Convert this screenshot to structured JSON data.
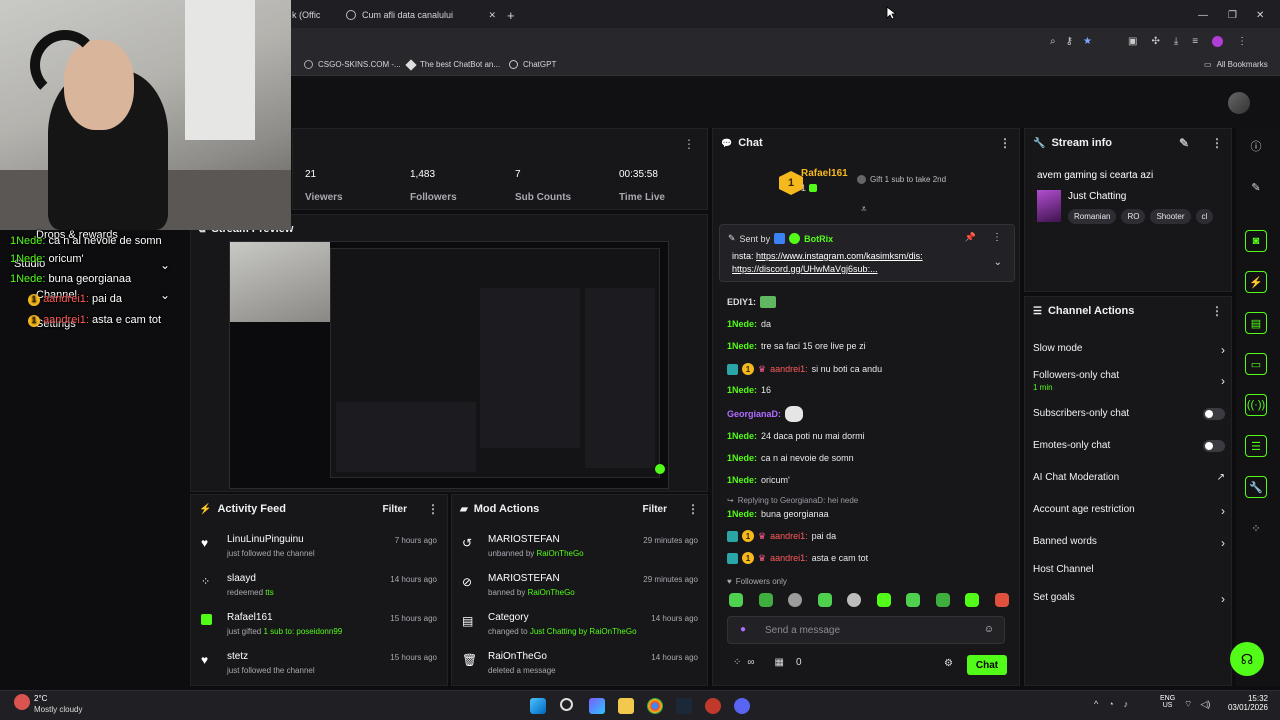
{
  "browser": {
    "tabs": [
      {
        "label": "k (Offic"
      },
      {
        "label": "Cum afli data canalului"
      }
    ],
    "bookmarks": [
      "CSGO-SKINS.COM -...",
      "The best ChatBot an...",
      "ChatGPT"
    ],
    "all_bookmarks": "All Bookmarks"
  },
  "stats": {
    "viewers": {
      "value": "21",
      "label": "Viewers"
    },
    "followers": {
      "value": "1,483",
      "label": "Followers"
    },
    "subs": {
      "value": "7",
      "label": "Sub Counts"
    },
    "time_live": {
      "value": "00:35:58",
      "label": "Time Live"
    }
  },
  "overlay_chat": [
    {
      "user": "1Nede:",
      "text": "ca n al nevoie de somn"
    },
    {
      "user": "1Nede:",
      "text": "oricum'"
    },
    {
      "user": "1Nede:",
      "text": "buna georgianaa"
    },
    {
      "user": "aandrei1:",
      "text": "pai da"
    },
    {
      "user": "aandrei1:",
      "text": "asta e cam tot"
    }
  ],
  "overlay_menu": [
    "Drops & rewards",
    "Studio",
    "Channel",
    "Settings"
  ],
  "stream_preview": {
    "title": "Stream Preview"
  },
  "chat": {
    "title": "Chat",
    "top_gifter": {
      "name": "Rafael161",
      "count": "1",
      "rank": "1",
      "cta": "Gift 1 sub to take 2nd"
    },
    "pinned": {
      "sent_by": "Sent by",
      "bot": "BotRix",
      "text_prefix": "insta:",
      "link1": "https://www.instagram.com/kasimksm/dis:",
      "link2": "https://discord.gg/UHwMaVgj6sub:..."
    },
    "messages": [
      {
        "user": "EDIY1:",
        "text": "",
        "type": "plain"
      },
      {
        "user": "1Nede:",
        "text": "da",
        "type": "green"
      },
      {
        "user": "1Nede:",
        "text": "tre sa faci 15 ore live pe zi",
        "type": "green"
      },
      {
        "user": "aandrei1:",
        "text": "si nu boti ca andu",
        "type": "red"
      },
      {
        "user": "1Nede:",
        "text": "16",
        "type": "green"
      },
      {
        "user": "GeorgianaD:",
        "text": "",
        "type": "purple"
      },
      {
        "user": "1Nede:",
        "text": "24 daca poti nu mai dormi",
        "type": "green"
      },
      {
        "user": "1Nede:",
        "text": "ca n ai nevoie de somn",
        "type": "green"
      },
      {
        "user": "1Nede:",
        "text": "oricum'",
        "type": "green"
      },
      {
        "user": "1Nede:",
        "text": "buna georgianaa",
        "type": "green"
      },
      {
        "user": "aandrei1:",
        "text": "pai da",
        "type": "red"
      },
      {
        "user": "aandrei1:",
        "text": "asta e cam tot",
        "type": "red"
      }
    ],
    "reply_note": "Replying to GeorgianaD: hei nede",
    "followers_only": "Followers only",
    "input_placeholder": "Send a message",
    "points": "0",
    "send_label": "Chat"
  },
  "stream_info": {
    "title": "Stream info",
    "stream_title": "avem gaming si cearta azi",
    "category": "Just Chatting",
    "tags": [
      "Romanian",
      "RO",
      "Shooter",
      "cl"
    ]
  },
  "channel_actions": {
    "title": "Channel Actions",
    "items": [
      {
        "label": "Slow mode"
      },
      {
        "label": "Followers-only chat",
        "sub": "1 min"
      },
      {
        "label": "Subscribers-only chat"
      },
      {
        "label": "Emotes-only chat"
      },
      {
        "label": "AI Chat Moderation"
      },
      {
        "label": "Account age restriction"
      },
      {
        "label": "Banned words"
      },
      {
        "label": "Host Channel"
      },
      {
        "label": "Set goals"
      }
    ]
  },
  "activity_feed": {
    "title": "Activity Feed",
    "filter": "Filter",
    "rows": [
      {
        "name": "LinuLinuPinguinu",
        "sub": "just followed the channel",
        "time": "7 hours ago",
        "icon": "heart-icon"
      },
      {
        "name": "slaayd",
        "sub": "redeemed",
        "highlight": "tts",
        "time": "14 hours ago",
        "icon": "points-icon"
      },
      {
        "name": "Rafael161",
        "sub": "just gifted",
        "highlight": "1 sub to: poseidonn99",
        "time": "15 hours ago",
        "icon": "gift-icon"
      },
      {
        "name": "stetz",
        "sub": "just followed the channel",
        "time": "15 hours ago",
        "icon": "heart-icon"
      }
    ]
  },
  "mod_actions": {
    "title": "Mod Actions",
    "filter": "Filter",
    "rows": [
      {
        "name": "MARIOSTEFAN",
        "sub": "unbanned by",
        "highlight": "RaiOnTheGo",
        "time": "29 minutes ago",
        "icon": "unban-icon"
      },
      {
        "name": "MARIOSTEFAN",
        "sub": "banned by",
        "highlight": "RaiOnTheGo",
        "time": "29 minutes ago",
        "icon": "ban-icon"
      },
      {
        "name": "Category",
        "sub": "changed to",
        "highlight": "Just Chatting by RaiOnTheGo",
        "time": "14 hours ago",
        "icon": "category-icon"
      },
      {
        "name": "RaiOnTheGo",
        "sub": "deleted a message",
        "time": "14 hours ago",
        "icon": "trash-icon"
      }
    ]
  },
  "taskbar": {
    "weather_temp": "2°C",
    "weather_desc": "Mostly cloudy",
    "lang": "ENG",
    "region": "US",
    "time": "15:32",
    "date": "03/01/2026"
  },
  "colors": {
    "accent": "#53fc18",
    "panel": "#17171a",
    "gold": "#f5b91d"
  }
}
